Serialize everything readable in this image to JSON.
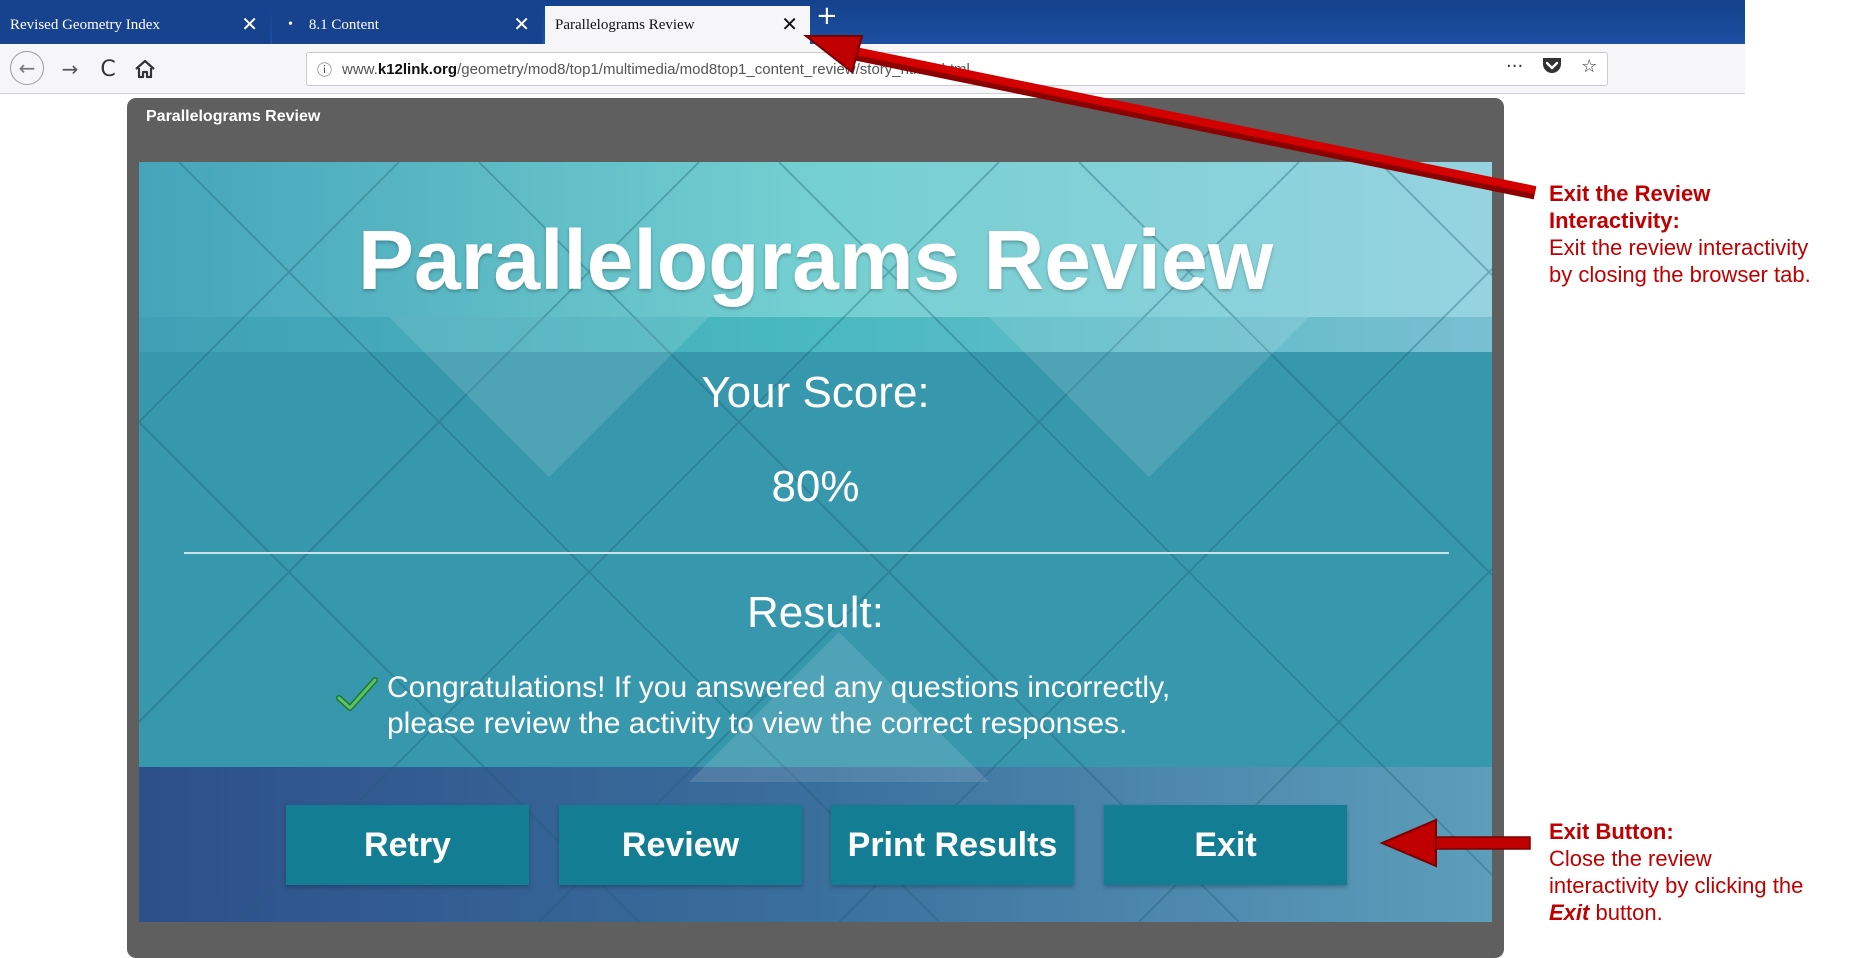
{
  "browser": {
    "tabs": [
      {
        "title": "Revised Geometry Index",
        "active": false
      },
      {
        "title": "8.1 Content",
        "active": false,
        "dot": "•"
      },
      {
        "title": "Parallelograms Review",
        "active": true
      }
    ],
    "tab_close_glyph": "✕",
    "new_tab_glyph": "+",
    "nav": {
      "back": "←",
      "forward": "→",
      "reload": "C",
      "home_icon": "home-icon"
    },
    "url": {
      "info_icon": "ⓘ",
      "prefix": "www.",
      "host": "k12link.org",
      "path": "/geometry/mod8/top1/multimedia/mod8top1_content_review/story_html5.html"
    },
    "page_actions": [
      "···",
      "pocket-icon",
      "☆"
    ]
  },
  "player": {
    "title": "Parallelograms Review",
    "slide": {
      "title": "Parallelograms Review",
      "score_label": "Your Score:",
      "score_value": "80%",
      "result_label": "Result:",
      "message_line1": "Congratulations! If you answered any questions incorrectly,",
      "message_line2": "please review the activity to view the correct responses.",
      "buttons": [
        "Retry",
        "Review",
        "Print Results",
        "Exit"
      ]
    }
  },
  "annotations": {
    "exit_review": {
      "heading1": "Exit the Review",
      "heading2": "Interactivity:",
      "body1": "Exit the review interactivity",
      "body2": "by closing the browser tab."
    },
    "exit_button": {
      "heading": "Exit Button:",
      "body1": "Close the review",
      "body2": "interactivity by clicking the",
      "body3_bold": "Exit",
      "body3_rest": " button."
    }
  },
  "colors": {
    "tabbar": "#1c4fa3",
    "slide_teal": "#3a9ab2",
    "button": "#137d93",
    "annotation_red": "#c00000",
    "player_frame": "#5f5f5f"
  }
}
